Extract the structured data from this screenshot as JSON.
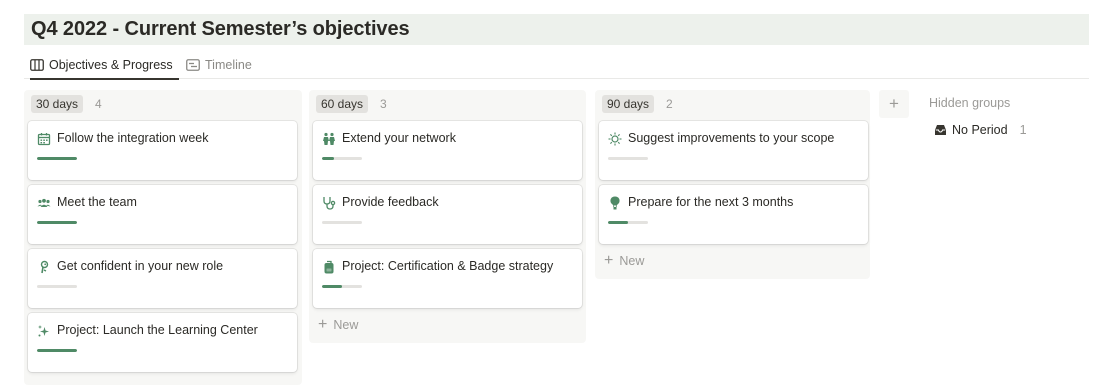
{
  "page": {
    "title": "Q4 2022 - Current Semester’s objectives"
  },
  "tabs": [
    {
      "label": "Objectives & Progress",
      "active": true,
      "icon": "board-icon"
    },
    {
      "label": "Timeline",
      "active": false,
      "icon": "timeline-icon"
    }
  ],
  "columns": [
    {
      "label": "30 days",
      "count": "4",
      "cards": [
        {
          "title": "Follow the integration week",
          "icon": "calendar-icon",
          "progress": 1.0
        },
        {
          "title": "Meet the team",
          "icon": "people-group-icon",
          "progress": 1.0
        },
        {
          "title": "Get confident in your new role",
          "icon": "figure-icon",
          "progress": 0.0
        },
        {
          "title": "Project: Launch the Learning Center",
          "icon": "sparkles-icon",
          "progress": 1.0
        }
      ]
    },
    {
      "label": "60 days",
      "count": "3",
      "cards": [
        {
          "title": "Extend your network",
          "icon": "two-people-icon",
          "progress": 0.3
        },
        {
          "title": "Provide feedback",
          "icon": "stethoscope-icon",
          "progress": 0.0
        },
        {
          "title": "Project: Certification & Badge strategy",
          "icon": "backpack-icon",
          "progress": 0.5
        }
      ],
      "new_label": "New"
    },
    {
      "label": "90 days",
      "count": "2",
      "cards": [
        {
          "title": "Suggest improvements to your scope",
          "icon": "sun-icon",
          "progress": 0.0
        },
        {
          "title": "Prepare for the next 3 months",
          "icon": "hot-air-balloon-icon",
          "progress": 0.5
        }
      ],
      "new_label": "New"
    }
  ],
  "add_group_label": "+",
  "hidden_groups": {
    "label": "Hidden groups",
    "items": [
      {
        "label": "No Period",
        "count": "1",
        "icon": "inbox-icon"
      }
    ]
  },
  "colors": {
    "accent_green": "#4f8a66",
    "title_bg": "#edf1ec",
    "column_bg": "#f7f7f5",
    "track": "#e3e2df"
  }
}
